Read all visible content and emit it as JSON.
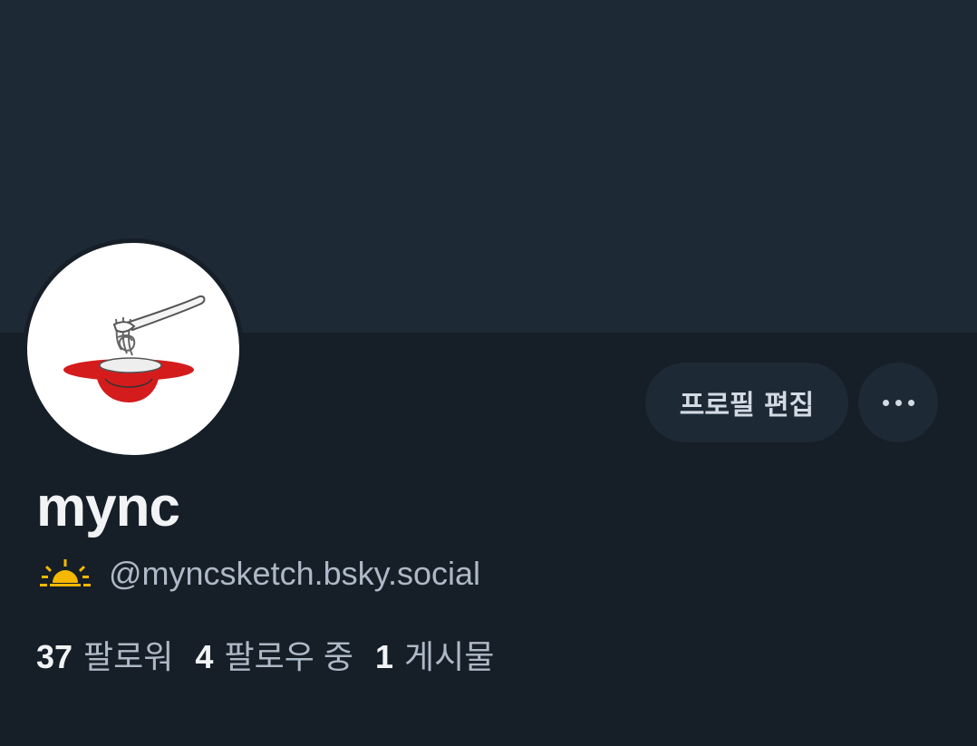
{
  "profile": {
    "display_name": "mync",
    "handle": "@myncsketch.bsky.social",
    "avatar_icon": "spaghetti-bowl-drawing",
    "handle_badge_icon": "sunrise-emoji-icon"
  },
  "actions": {
    "edit_profile_label": "프로필 편집",
    "more_icon": "ellipsis-icon"
  },
  "stats": {
    "followers_count": "37",
    "followers_label": "팔로워",
    "following_count": "4",
    "following_label": "팔로우 중",
    "posts_count": "1",
    "posts_label": "게시물"
  },
  "colors": {
    "background": "#161e27",
    "banner": "#1e2936",
    "button_bg": "#1e2936",
    "text_primary": "#f1f3f5",
    "text_secondary": "#aeb9c7",
    "sunrise": "#f5b800"
  }
}
